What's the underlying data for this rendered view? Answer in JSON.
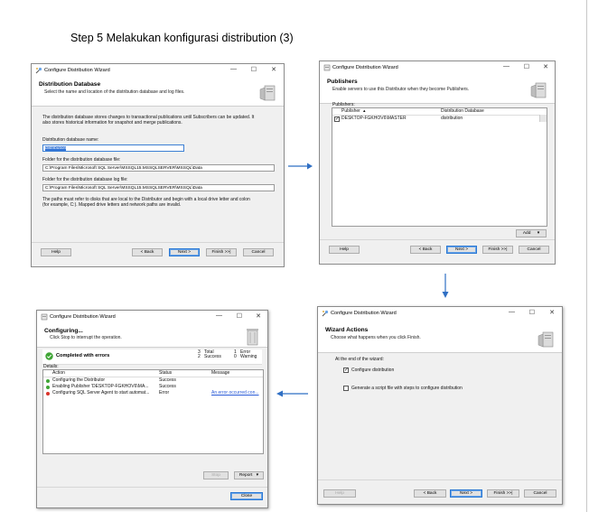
{
  "page": {
    "title": "Step 5 Melakukan konfigurasi distribution (3)"
  },
  "win1": {
    "title": "Configure Distribution Wizard",
    "header_title": "Distribution Database",
    "header_sub": "Select the name and location of the distribution database and log files.",
    "desc1": "The distribution database stores changes to transactional publications until Subscribers can be updated. It",
    "desc2": "also stores historical information for snapshot and merge publications.",
    "db_name_label": "Distribution database name:",
    "db_name_value": "distribution",
    "data_folder_label": "Folder for the distribution database file:",
    "data_folder_value": "C:\\Program Files\\Microsoft SQL Server\\MSSQL15.MSSQLSERVER\\MSSQL\\Data",
    "log_folder_label": "Folder for the distribution database log file:",
    "log_folder_value": "C:\\Program Files\\Microsoft SQL Server\\MSSQL15.MSSQLSERVER\\MSSQL\\Data",
    "note1": "The paths must refer to disks that are local to the Distributor and begin with a local drive letter and colon",
    "note2": "(for example, C:). Mapped drive letters and network paths are invalid.",
    "buttons": {
      "help": "Help",
      "back": "< Back",
      "next": "Next >",
      "finish": "Finish >>|",
      "cancel": "Cancel"
    }
  },
  "win2": {
    "title": "Configure Distribution Wizard",
    "header_title": "Publishers",
    "header_sub": "Enable servers to use this Distributor when they become Publishers.",
    "publishers_label": "Publishers:",
    "col_publisher": "Publisher",
    "col_db": "Distribution Database",
    "rows": [
      {
        "publisher": "DESKTOP-FGKHOV6\\MASTER",
        "db": "distribution"
      }
    ],
    "add_button": "Add",
    "buttons": {
      "help": "Help",
      "back": "< Back",
      "next": "Next >",
      "finish": "Finish >>|",
      "cancel": "Cancel"
    }
  },
  "win3": {
    "title": "Configure Distribution Wizard",
    "header_title": "Configuring...",
    "header_sub": "Click Stop to interrupt the operation.",
    "status": "Completed with errors",
    "total_count": "3",
    "total_label": "Total",
    "success_count": "2",
    "success_label": "Success",
    "error_count": "1",
    "error_label": "Error",
    "warning_count": "0",
    "warning_label": "Warning",
    "details_label": "Details:",
    "col_action": "Action",
    "col_status": "Status",
    "col_message": "Message",
    "rows": [
      {
        "action": "Configuring the Distributor",
        "status": "Success",
        "message": ""
      },
      {
        "action": "Enabling Publisher 'DESKTOP-FGKHOV6\\MA...",
        "status": "Success",
        "message": ""
      },
      {
        "action": "Configuring SQL Server Agent to start automat...",
        "status": "Error",
        "message": "An error occurred con..."
      }
    ],
    "stop_button": "Stop",
    "report_button": "Report",
    "close_button": "Close"
  },
  "win4": {
    "title": "Configure Distribution Wizard",
    "header_title": "Wizard Actions",
    "header_sub": "Choose what happens when you click Finish.",
    "end_label": "At the end of the wizard:",
    "opt1": "Configure distribution",
    "opt2": "Generate a script file with steps to configure distribution",
    "buttons": {
      "help": "Help",
      "back": "< Back",
      "next": "Next >",
      "finish": "Finish >>|",
      "cancel": "Cancel"
    }
  },
  "colors": {
    "arrow": "#2f6fc4",
    "success": "#3fa535",
    "error": "#d9342b",
    "selection": "#3375d6"
  }
}
